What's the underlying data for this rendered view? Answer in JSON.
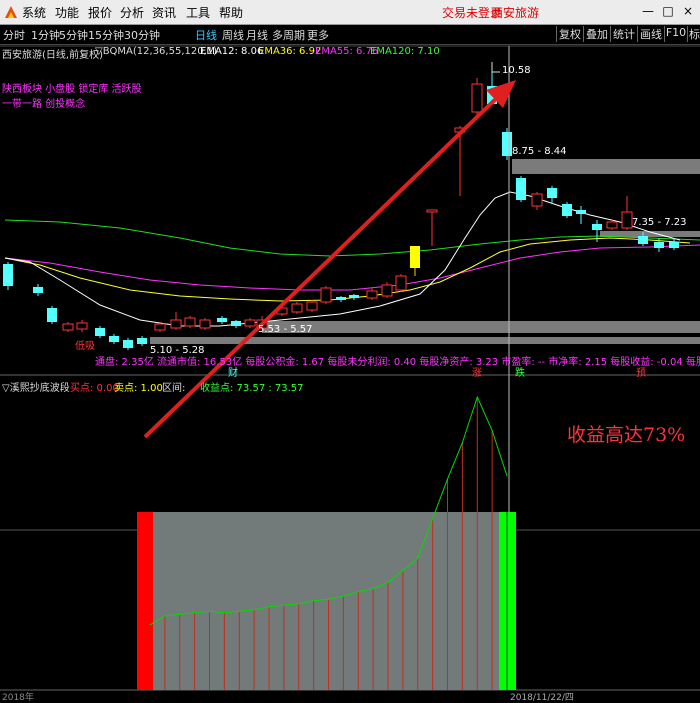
{
  "menubar": {
    "items": [
      "系统",
      "功能",
      "报价",
      "分析",
      "资讯",
      "工具",
      "帮助"
    ],
    "notice_login": "交易未登录",
    "notice_stock": "西安旅游",
    "win_buttons": [
      "—",
      "□",
      "×"
    ]
  },
  "toolbar": {
    "periods": [
      "分时",
      "1分钟",
      "5分钟",
      "15分钟",
      "30分钟",
      "日线",
      "周线",
      "月线",
      "多周期",
      "更多"
    ],
    "active_period": "日线",
    "right_buttons": [
      "复权",
      "叠加",
      "统计",
      "画线",
      "F10",
      "标记"
    ]
  },
  "main_chart": {
    "title": "西安旅游(日线,前复权)",
    "formula": "▽BQMA(12,36,55,120,1)",
    "ema": [
      {
        "label": "EMA12: 8.06",
        "color": "#ffffff"
      },
      {
        "label": "EMA36: 6.92",
        "color": "#ffff00"
      },
      {
        "label": "EMA55: 6.76",
        "color": "#ff33ff"
      },
      {
        "label": "EMA120: 7.10",
        "color": "#33ff33"
      }
    ],
    "concepts_line1": "陕西板块 小盘股 锁定库 活跃股",
    "concepts_line2": "一带一路 创投概念",
    "high_label": "10.58",
    "range_label_1": "8.75 - 8.44",
    "range_label_2": "7.35 - 7.23",
    "range_label_3": "5.53 - 5.57",
    "range_label_4": "5.10 - 5.28",
    "low_marker": "低吸",
    "fundamentals": {
      "text": "通盘: 2.35亿  流通市值: 16.53亿   每股公积金: 1.67   每股未分利润: 0.40   每股净资产: 3.23   市盈率: --   市净率: 2.15   每股收益: -0.04   每股现金",
      "markers": [
        "财",
        "涨",
        "跌",
        "预"
      ]
    }
  },
  "sub_chart": {
    "title": "▽溪熙抄底波段",
    "buy_label": "买点: 0.00",
    "sell_label": "卖点: 1.00",
    "range_label": "区间:",
    "profit_label": "收益点: 73.57 : 73.57",
    "annotation": "收益高达73%",
    "profit_values": [
      0,
      3,
      3.5,
      4,
      4.5,
      4,
      4.5,
      5,
      6,
      6.5,
      7,
      8,
      8.5,
      9.5,
      11,
      12,
      14,
      18,
      22,
      35,
      48,
      60,
      75,
      64,
      49
    ]
  },
  "bottom_axis": {
    "left_date": "2018年",
    "cursor_date": "2018/11/22/四"
  },
  "colors": {
    "up": "#ff3333",
    "down": "#54ffff",
    "yellow_candle": "#ffff00",
    "arrow": "#e02020",
    "profit_line": "#00dd00",
    "shade": "#737a7a",
    "buy_block": "#ff0000",
    "sell_block": "#00ff00"
  }
}
